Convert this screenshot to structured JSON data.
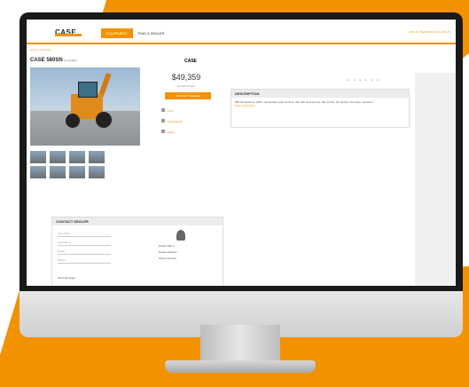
{
  "colors": {
    "accent": "#f39200",
    "bezel": "#1a1a1a"
  },
  "header": {
    "logo": "CASE",
    "nav": [
      "EQUIPMENT",
      "FIND A DEALER"
    ],
    "right_text": "LOG IN / REGISTER   FOLLOW US"
  },
  "breadcrumb": "Home > Inventory",
  "listing": {
    "title": "CASE 580SN",
    "title_suffix": "(or similar)",
    "brand": "CASE",
    "price": "$49,359",
    "price_note": "Contact Dealer",
    "contact_label": "CONTACT DEALER",
    "options": [
      "Print",
      "Email Dealer",
      "Share"
    ],
    "thumb_count": 8
  },
  "description": {
    "heading": "DESCRIPTION",
    "body": "580 SN backhoe, 4WD, extendahoe, pilot controls, cab with heat and air, ride control, 24\" bucket, 3rd valve, serviced.",
    "link": "More information"
  },
  "contact_form": {
    "heading": "CONTACT DEALER",
    "fields": [
      "First Name",
      "Last Name",
      "Email",
      "Phone"
    ],
    "dealer_lines": [
      "Dealer Name",
      "Dealer Address",
      "Phone Number"
    ],
    "submit": "Send Message"
  }
}
